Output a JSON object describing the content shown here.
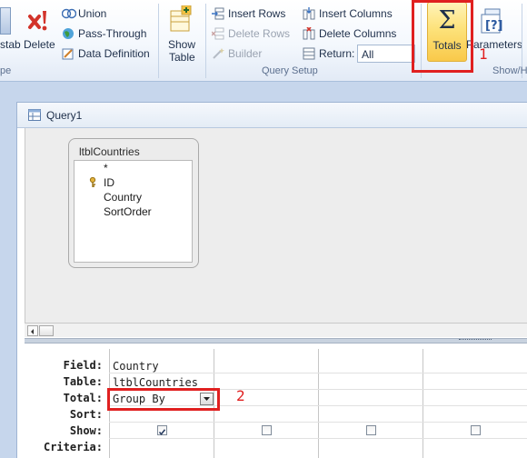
{
  "ribbon": {
    "crosstab_label": "stab",
    "delete_label": "Delete",
    "union_label": "Union",
    "passthrough_label": "Pass-Through",
    "data_definition_label": "Data Definition",
    "show_table_line1": "Show",
    "show_table_line2": "Table",
    "insert_rows_label": "Insert Rows",
    "delete_rows_label": "Delete Rows",
    "builder_label": "Builder",
    "insert_columns_label": "Insert Columns",
    "delete_columns_label": "Delete Columns",
    "return_label": "Return:",
    "return_value": "All",
    "totals_label": "Totals",
    "totals_symbol": "Σ",
    "parameters_label": "Parameters",
    "group_query_type_partial": "pe",
    "group_query_setup": "Query Setup",
    "group_show_hide_partial": "Show/H"
  },
  "annotations": {
    "marker_1": "1",
    "marker_2": "2"
  },
  "document": {
    "tab_title": "Query1"
  },
  "table": {
    "name": "ltblCountries",
    "fields": [
      "*",
      "ID",
      "Country",
      "SortOrder"
    ]
  },
  "grid": {
    "row_labels": {
      "field": "Field:",
      "table": "Table:",
      "total": "Total:",
      "sort": "Sort:",
      "show": "Show:",
      "criteria": "Criteria:"
    },
    "column1": {
      "field": "Country",
      "table": "ltblCountries",
      "total": "Group By",
      "show": true
    }
  },
  "colors": {
    "highlight": "#e02020",
    "totals_active": "#fde27a"
  }
}
